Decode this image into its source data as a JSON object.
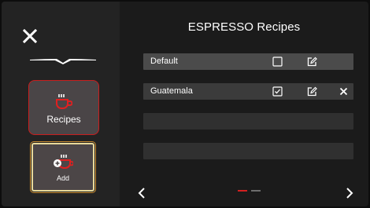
{
  "header": {
    "title": "ESPRESSO Recipes"
  },
  "sidebar": {
    "tiles": [
      {
        "label": "Recipes",
        "icon": "coffee-cup-icon"
      },
      {
        "label": "Add",
        "icon": "add-coffee-icon"
      }
    ]
  },
  "recipes": [
    {
      "name": "Default",
      "checked": false,
      "actions": [
        "checkbox-icon",
        "edit-icon"
      ]
    },
    {
      "name": "Guatemala",
      "checked": true,
      "actions": [
        "checkbox-checked-icon",
        "edit-icon",
        "delete-icon"
      ]
    },
    {
      "name": ""
    },
    {
      "name": ""
    }
  ],
  "pagination": {
    "pages": 2,
    "current": 1
  },
  "colors": {
    "accent": "#c81e1e",
    "highlight": "#e8d99a",
    "background": "#1b1b1b"
  }
}
